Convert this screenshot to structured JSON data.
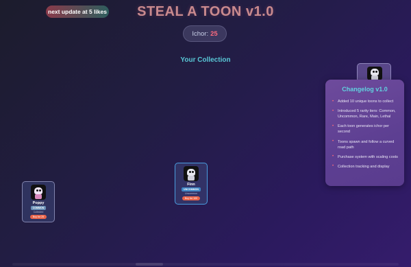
{
  "header": {
    "badge": "next update at 5 likes",
    "title": "STEAL A TOON v1.0",
    "ichor_label": "Ichor:",
    "ichor_value": "25"
  },
  "collection": {
    "title": "Your Collection"
  },
  "toons": [
    {
      "name": "Poppy",
      "rarity": "COMMON",
      "rarity_color": "#6a8fb6",
      "desc": "Collected",
      "buy": "Buy for 25"
    },
    {
      "name": "Finn",
      "rarity": "UNCOMMON",
      "rarity_color": "#3f86c4",
      "desc": "Uncommon",
      "buy": "Buy for 100"
    }
  ],
  "changelog": {
    "title": "Changelog v1.0",
    "items": [
      "Added 10 unique toons to collect",
      "Introduced 5 rarity tiers: Common, Uncommon, Rare, Main, Lethal",
      "Each toon generates ichor per second",
      "Toons spawn and follow a curved road path",
      "Purchase system with scaling costs",
      "Collection tracking and display"
    ]
  },
  "colors": {
    "accent_title": "#c98a8e",
    "accent_cyan": "#59c7d6",
    "ichor_value": "#ff6b7e",
    "buy_button": "#e8644a"
  }
}
